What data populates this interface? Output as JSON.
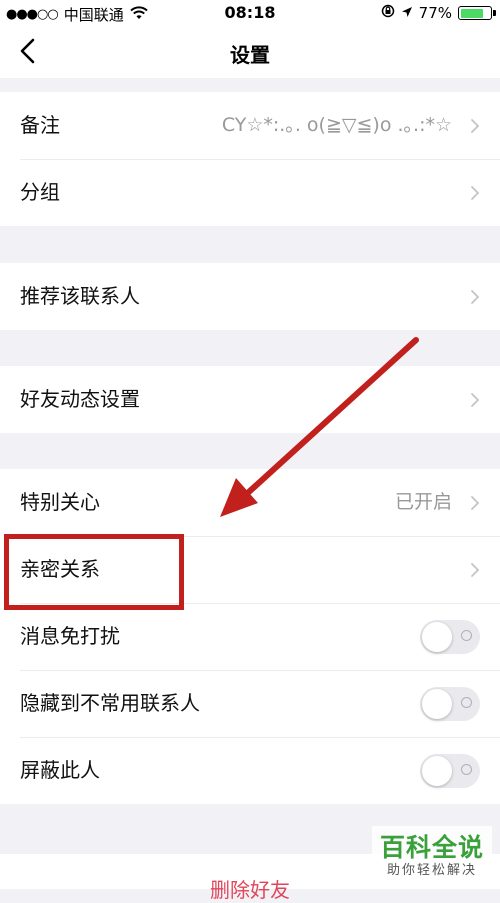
{
  "status_bar": {
    "signal_dots": "●●●○○",
    "carrier": "中国联通",
    "time": "08:18",
    "battery_percent": "77%",
    "battery_level": 0.77,
    "battery_color": "#4cd964"
  },
  "nav": {
    "title": "设置"
  },
  "rows": {
    "remark": {
      "label": "备注",
      "value": "CY☆*:.｡. o(≧▽≦)o .｡.:*☆"
    },
    "group": {
      "label": "分组"
    },
    "recommend": {
      "label": "推荐该联系人"
    },
    "moments": {
      "label": "好友动态设置"
    },
    "special_care": {
      "label": "特别关心",
      "value": "已开启"
    },
    "intimate": {
      "label": "亲密关系"
    },
    "dnd": {
      "label": "消息免打扰",
      "on": false
    },
    "hide_uncommon": {
      "label": "隐藏到不常用联系人",
      "on": false
    },
    "block": {
      "label": "屏蔽此人",
      "on": false
    }
  },
  "delete_label": "删除好友",
  "watermark": {
    "title": "百科全说",
    "subtitle": "助你轻松解决"
  },
  "colors": {
    "annotation": "#c1201c",
    "delete": "#e0465a",
    "background": "#f2f2f6"
  }
}
